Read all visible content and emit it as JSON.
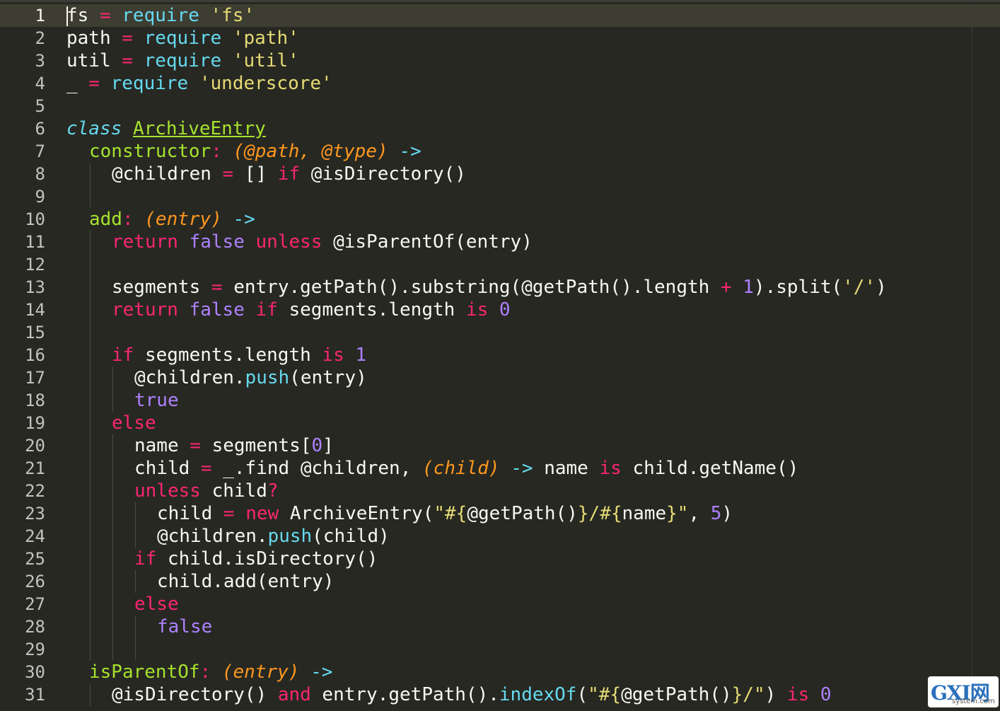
{
  "editor": {
    "current_line": 1,
    "colors": {
      "background": "#272822",
      "keyword": "#f92672",
      "builtin": "#66d9ef",
      "string": "#e6db74",
      "function": "#a6e22e",
      "parameter": "#fd971f",
      "constant": "#ae81ff",
      "text": "#f8f8f2"
    },
    "lines": [
      {
        "n": "1",
        "indent": 0,
        "tokens": [
          [
            "fs",
            "plain"
          ],
          [
            " = ",
            "pink"
          ],
          [
            "require",
            "cyan"
          ],
          [
            " ",
            "plain"
          ],
          [
            "'fs'",
            "str"
          ]
        ]
      },
      {
        "n": "2",
        "indent": 0,
        "tokens": [
          [
            "path",
            "plain"
          ],
          [
            " = ",
            "pink"
          ],
          [
            "require",
            "cyan"
          ],
          [
            " ",
            "plain"
          ],
          [
            "'path'",
            "str"
          ]
        ]
      },
      {
        "n": "3",
        "indent": 0,
        "tokens": [
          [
            "util",
            "plain"
          ],
          [
            " = ",
            "pink"
          ],
          [
            "require",
            "cyan"
          ],
          [
            " ",
            "plain"
          ],
          [
            "'util'",
            "str"
          ]
        ]
      },
      {
        "n": "4",
        "indent": 0,
        "tokens": [
          [
            "_",
            "plain"
          ],
          [
            " = ",
            "pink"
          ],
          [
            "require",
            "cyan"
          ],
          [
            " ",
            "plain"
          ],
          [
            "'underscore'",
            "str"
          ]
        ]
      },
      {
        "n": "5",
        "indent": 0,
        "tokens": []
      },
      {
        "n": "6",
        "indent": 0,
        "tokens": [
          [
            "class",
            "kwi"
          ],
          [
            " ",
            "plain"
          ],
          [
            "ArchiveEntry",
            "cls"
          ]
        ]
      },
      {
        "n": "7",
        "indent": 1,
        "tokens": [
          [
            "constructor",
            "green"
          ],
          [
            ": ",
            "pink"
          ],
          [
            "(@path, @type)",
            "orange"
          ],
          [
            " ",
            "plain"
          ],
          [
            "->",
            "cyan"
          ]
        ]
      },
      {
        "n": "8",
        "indent": 2,
        "tokens": [
          [
            "@children",
            "plain"
          ],
          [
            " = ",
            "pink"
          ],
          [
            "[] ",
            "plain"
          ],
          [
            "if",
            "pink"
          ],
          [
            " @isDirectory()",
            "plain"
          ]
        ]
      },
      {
        "n": "9",
        "indent": 0,
        "tokens": []
      },
      {
        "n": "10",
        "indent": 1,
        "tokens": [
          [
            "add",
            "green"
          ],
          [
            ": ",
            "pink"
          ],
          [
            "(entry)",
            "orange"
          ],
          [
            " ",
            "plain"
          ],
          [
            "->",
            "cyan"
          ]
        ]
      },
      {
        "n": "11",
        "indent": 2,
        "tokens": [
          [
            "return",
            "pink"
          ],
          [
            " ",
            "plain"
          ],
          [
            "false",
            "purple"
          ],
          [
            " ",
            "plain"
          ],
          [
            "unless",
            "pink"
          ],
          [
            " @isParentOf(entry)",
            "plain"
          ]
        ]
      },
      {
        "n": "12",
        "indent": 0,
        "tokens": []
      },
      {
        "n": "13",
        "indent": 2,
        "tokens": [
          [
            "segments",
            "plain"
          ],
          [
            " = ",
            "pink"
          ],
          [
            "entry.getPath().substring(@getPath().length ",
            "plain"
          ],
          [
            "+",
            "pink"
          ],
          [
            " ",
            "plain"
          ],
          [
            "1",
            "purple"
          ],
          [
            ").split(",
            "plain"
          ],
          [
            "'/'",
            "str"
          ],
          [
            ")",
            "plain"
          ]
        ]
      },
      {
        "n": "14",
        "indent": 2,
        "tokens": [
          [
            "return",
            "pink"
          ],
          [
            " ",
            "plain"
          ],
          [
            "false",
            "purple"
          ],
          [
            " ",
            "plain"
          ],
          [
            "if",
            "pink"
          ],
          [
            " segments.length ",
            "plain"
          ],
          [
            "is",
            "pink"
          ],
          [
            " ",
            "plain"
          ],
          [
            "0",
            "purple"
          ]
        ]
      },
      {
        "n": "15",
        "indent": 0,
        "tokens": []
      },
      {
        "n": "16",
        "indent": 2,
        "tokens": [
          [
            "if",
            "pink"
          ],
          [
            " segments.length ",
            "plain"
          ],
          [
            "is",
            "pink"
          ],
          [
            " ",
            "plain"
          ],
          [
            "1",
            "purple"
          ]
        ]
      },
      {
        "n": "17",
        "indent": 3,
        "tokens": [
          [
            "@children.",
            "plain"
          ],
          [
            "push",
            "cyan"
          ],
          [
            "(entry)",
            "plain"
          ]
        ]
      },
      {
        "n": "18",
        "indent": 3,
        "tokens": [
          [
            "true",
            "purple"
          ]
        ]
      },
      {
        "n": "19",
        "indent": 2,
        "tokens": [
          [
            "else",
            "pink"
          ]
        ]
      },
      {
        "n": "20",
        "indent": 3,
        "tokens": [
          [
            "name",
            "plain"
          ],
          [
            " = ",
            "pink"
          ],
          [
            "segments[",
            "plain"
          ],
          [
            "0",
            "purple"
          ],
          [
            "]",
            "plain"
          ]
        ]
      },
      {
        "n": "21",
        "indent": 3,
        "tokens": [
          [
            "child",
            "plain"
          ],
          [
            " = ",
            "pink"
          ],
          [
            "_.find @children, ",
            "plain"
          ],
          [
            "(child)",
            "orange"
          ],
          [
            " ",
            "plain"
          ],
          [
            "->",
            "cyan"
          ],
          [
            " name ",
            "plain"
          ],
          [
            "is",
            "pink"
          ],
          [
            " child.getName()",
            "plain"
          ]
        ]
      },
      {
        "n": "22",
        "indent": 3,
        "tokens": [
          [
            "unless",
            "pink"
          ],
          [
            " child",
            "plain"
          ],
          [
            "?",
            "pink"
          ]
        ]
      },
      {
        "n": "23",
        "indent": 4,
        "tokens": [
          [
            "child",
            "plain"
          ],
          [
            " = ",
            "pink"
          ],
          [
            "new",
            "pink"
          ],
          [
            " ArchiveEntry(",
            "plain"
          ],
          [
            "\"#{",
            "str"
          ],
          [
            "@getPath()",
            "plain"
          ],
          [
            "}/#{",
            "str"
          ],
          [
            "name",
            "plain"
          ],
          [
            "}\"",
            "str"
          ],
          [
            ", ",
            "plain"
          ],
          [
            "5",
            "purple"
          ],
          [
            ")",
            "plain"
          ]
        ]
      },
      {
        "n": "24",
        "indent": 4,
        "tokens": [
          [
            "@children.",
            "plain"
          ],
          [
            "push",
            "cyan"
          ],
          [
            "(child)",
            "plain"
          ]
        ]
      },
      {
        "n": "25",
        "indent": 3,
        "tokens": [
          [
            "if",
            "pink"
          ],
          [
            " child.isDirectory()",
            "plain"
          ]
        ]
      },
      {
        "n": "26",
        "indent": 4,
        "tokens": [
          [
            "child.add(entry)",
            "plain"
          ]
        ]
      },
      {
        "n": "27",
        "indent": 3,
        "tokens": [
          [
            "else",
            "pink"
          ]
        ]
      },
      {
        "n": "28",
        "indent": 4,
        "tokens": [
          [
            "false",
            "purple"
          ]
        ]
      },
      {
        "n": "29",
        "indent": 0,
        "tokens": []
      },
      {
        "n": "30",
        "indent": 1,
        "tokens": [
          [
            "isParentOf",
            "green"
          ],
          [
            ": ",
            "pink"
          ],
          [
            "(entry)",
            "orange"
          ],
          [
            " ",
            "plain"
          ],
          [
            "->",
            "cyan"
          ]
        ]
      },
      {
        "n": "31",
        "indent": 2,
        "tokens": [
          [
            "@isDirectory() ",
            "plain"
          ],
          [
            "and",
            "pink"
          ],
          [
            " entry.getPath().",
            "plain"
          ],
          [
            "indexOf",
            "cyan"
          ],
          [
            "(",
            "plain"
          ],
          [
            "\"#{",
            "str"
          ],
          [
            "@getPath()",
            "plain"
          ],
          [
            "}/\"",
            "str"
          ],
          [
            ") ",
            "plain"
          ],
          [
            "is",
            "pink"
          ],
          [
            " ",
            "plain"
          ],
          [
            "0",
            "purple"
          ]
        ]
      }
    ]
  },
  "watermark": {
    "logo": "GXI网",
    "sub": "system.com"
  }
}
